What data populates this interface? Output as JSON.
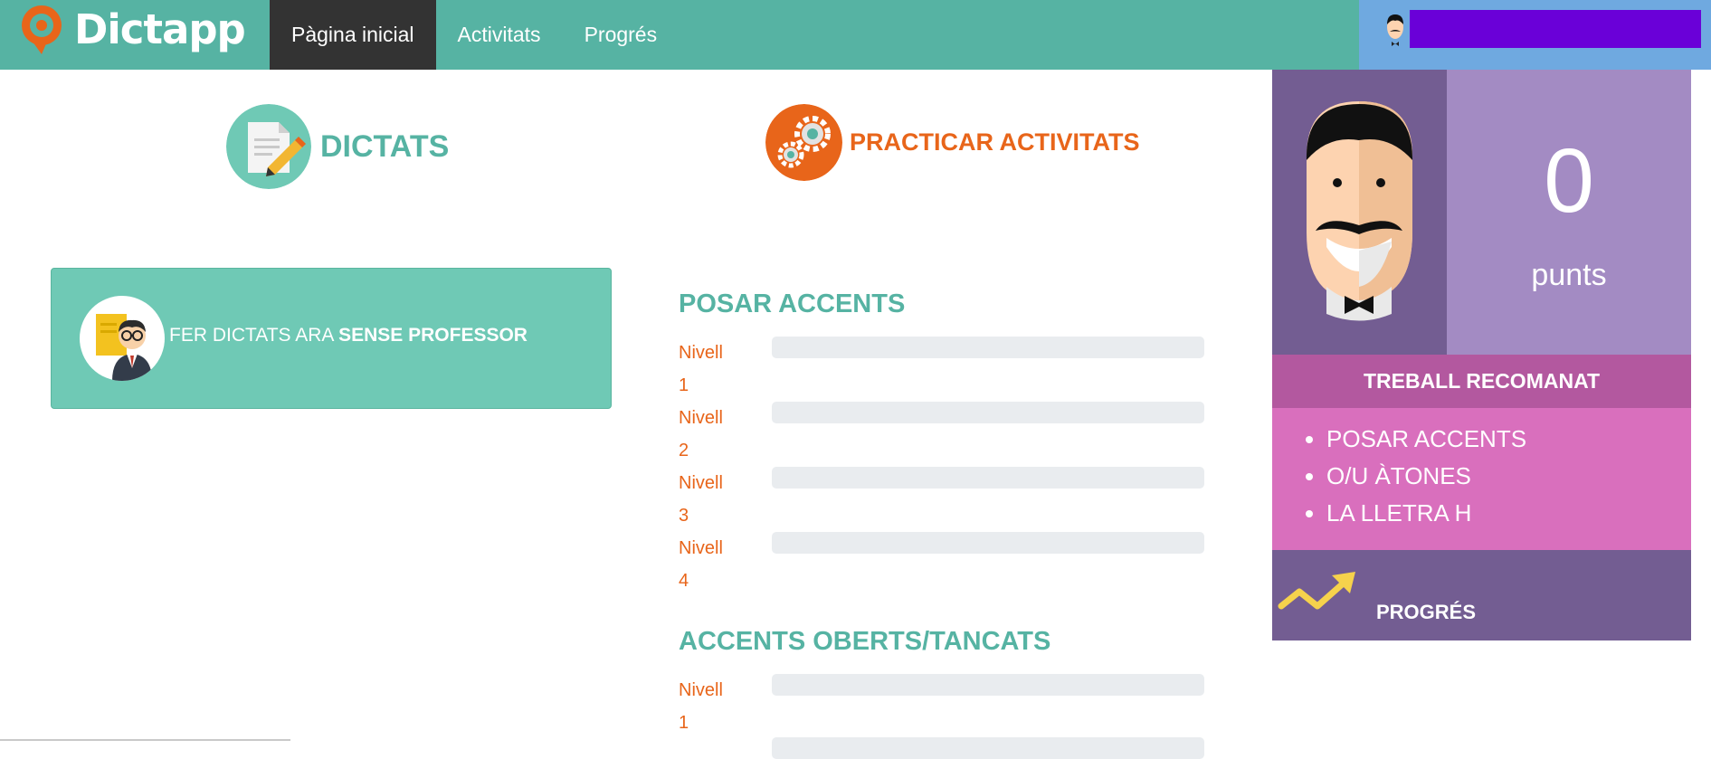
{
  "app": {
    "name": "Dictapp"
  },
  "nav": {
    "items": [
      {
        "label": "Pàgina inicial",
        "active": true
      },
      {
        "label": "Activitats",
        "active": false
      },
      {
        "label": "Progrés",
        "active": false
      }
    ]
  },
  "sections": {
    "dictats": {
      "title": "DICTATS",
      "icon": "document-pencil-icon"
    },
    "practicar": {
      "title": "PRACTICAR ACTIVITATS",
      "icon": "gears-icon"
    }
  },
  "dictat_card": {
    "text_prefix": "FER DICTATS ARA ",
    "text_bold": "SENSE PROFESSOR",
    "icon": "teacher-avatar-icon"
  },
  "activity_groups": [
    {
      "title": "POSAR ACCENTS",
      "levels": [
        {
          "word": "Nivell",
          "num": "1"
        },
        {
          "word": "Nivell",
          "num": "2"
        },
        {
          "word": "Nivell",
          "num": "3"
        },
        {
          "word": "Nivell",
          "num": "4"
        }
      ]
    },
    {
      "title": "ACCENTS OBERTS/TANCATS",
      "levels": [
        {
          "word": "Nivell",
          "num": "1"
        }
      ]
    }
  ],
  "score": {
    "value": "0",
    "label": "punts"
  },
  "recommended": {
    "title": "TREBALL RECOMANAT",
    "items": [
      "POSAR ACCENTS",
      "O/U ÀTONES",
      "LA LLETRA H"
    ]
  },
  "progress": {
    "label": "PROGRÉS"
  },
  "colors": {
    "teal": "#56b3a3",
    "orange": "#e8651a",
    "purple_dark": "#735d92",
    "purple_light": "#a38bc3",
    "magenta": "#b3589f",
    "pink": "#d96fbd",
    "user_bar": "#6a00d8"
  }
}
